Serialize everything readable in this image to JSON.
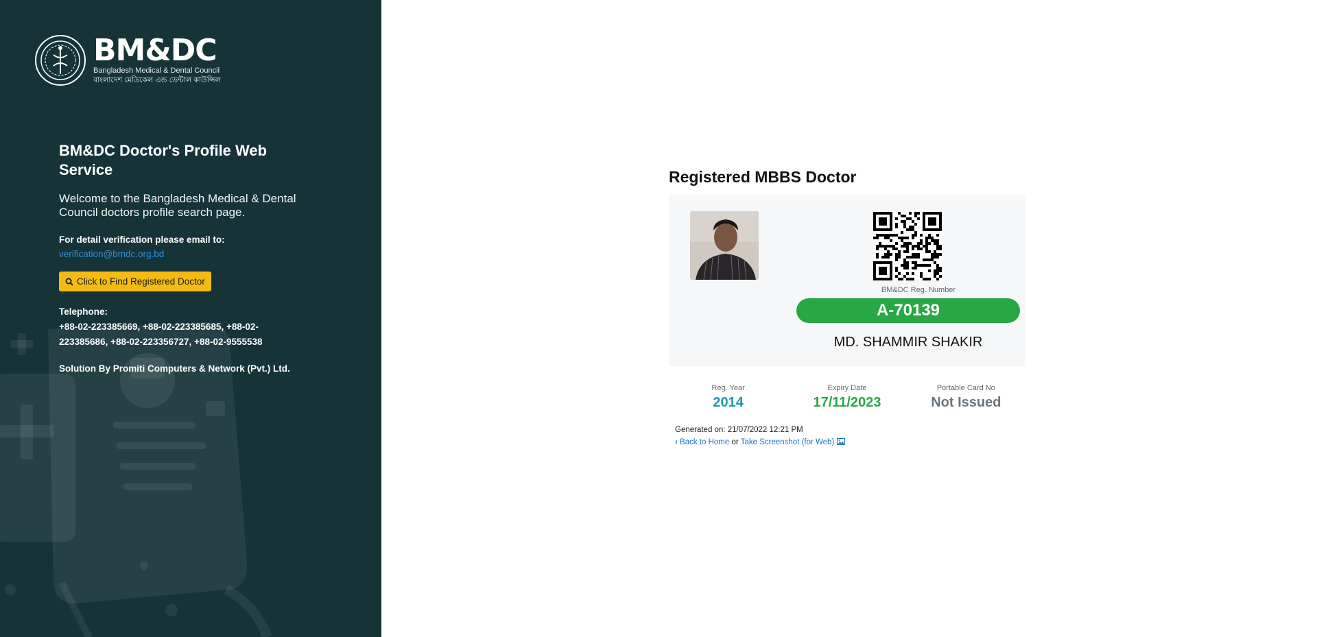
{
  "sidebar": {
    "logo": {
      "title": "BM&DC",
      "subtitle_en": "Bangladesh Medical & Dental Council",
      "subtitle_bn": "বাংলাদেশ মেডিকেল এন্ড ডেন্টাল কাউন্সিল"
    },
    "heading": "BM&DC Doctor's Profile Web Service",
    "welcome": "Welcome to the Bangladesh Medical & Dental Council doctors profile search page.",
    "verification_label": "For detail verification please email to:",
    "verification_email": "verification@bmdc.org.bd",
    "find_button_label": "Click to Find Registered Doctor",
    "telephone_label": "Telephone:",
    "telephone_value": "+88-02-223385669, +88-02-223385685, +88-02-223385686, +88-02-223356727, +88-02-9555538",
    "solution": "Solution By Promiti Computers & Network (Pvt.) Ltd.",
    "colors": {
      "background": "#163338",
      "button": "#f5bb12",
      "link": "#2f8fe0"
    }
  },
  "main": {
    "title": "Registered MBBS Doctor",
    "reg_number_caption": "BM&DC Reg. Number",
    "reg_number": "A-70139",
    "doctor_name": "MD. SHAMMIR SHAKIR",
    "stats": [
      {
        "label": "Reg. Year",
        "value": "2014",
        "color": "#1a9bb0"
      },
      {
        "label": "Expiry Date",
        "value": "17/11/2023",
        "color": "#28a745"
      },
      {
        "label": "Portable Card No",
        "value": "Not Issued",
        "color": "#6c757d"
      }
    ],
    "generated_on": "Generated on: 21/07/2022 12:21 PM",
    "back_link": "Back to Home",
    "or_text": "or",
    "screenshot_link": "Take Screenshot (for Web)",
    "colors": {
      "reg_badge": "#28a745",
      "link": "#1a73c9"
    }
  }
}
